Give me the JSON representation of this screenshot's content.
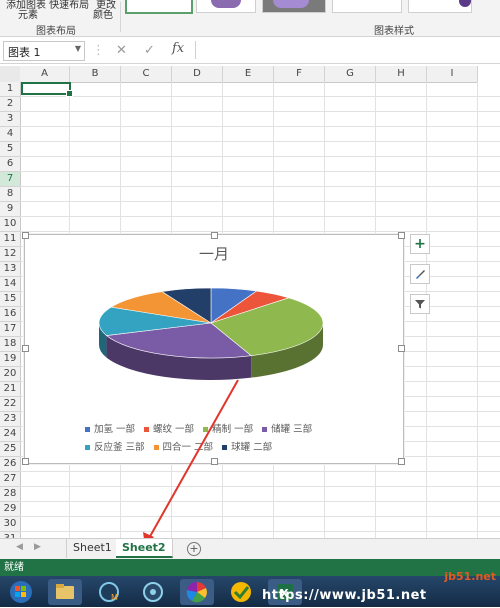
{
  "ribbon": {
    "btn_add_element_top": "添加图表 快速布局",
    "btn_add_element_bottom": "元素",
    "btn_change_color_top": "更改",
    "btn_change_color_bottom": "颜色",
    "group_layout": "图表布局",
    "group_styles": "图表样式"
  },
  "formula_bar": {
    "name_box": "图表 1",
    "cancel_icon": "✕",
    "enter_icon": "✓",
    "fx_label": "fx",
    "value": ""
  },
  "grid": {
    "columns": [
      "A",
      "B",
      "C",
      "D",
      "E",
      "F",
      "G",
      "H",
      "I"
    ],
    "rows": [
      "1",
      "2",
      "3",
      "4",
      "5",
      "6",
      "7",
      "8",
      "9",
      "10",
      "11",
      "12",
      "13",
      "14",
      "15",
      "16",
      "17",
      "18",
      "19",
      "20",
      "21",
      "22",
      "23",
      "24",
      "25",
      "26",
      "27",
      "28",
      "29",
      "30",
      "31"
    ],
    "selected_row": "7"
  },
  "chart_data": {
    "type": "pie",
    "title": "一月",
    "style": "3d",
    "categories": [
      "加氢 一部",
      "螺纹 一部",
      "精制 一部",
      "储罐 三部",
      "反应釜 三部",
      "四合一 二部",
      "球罐 二部"
    ],
    "colors": [
      "#4472c4",
      "#ed553b",
      "#8fb84f",
      "#7a5ba6",
      "#34a3c1",
      "#f39535",
      "#213f69"
    ]
  },
  "chart_tools": {
    "add_icon": "+",
    "brush_icon": "brush-icon",
    "filter_icon": "filter-icon"
  },
  "sheets": {
    "tabs": [
      "Sheet1",
      "Sheet2"
    ],
    "active": "Sheet2",
    "add": "+"
  },
  "status": {
    "text": "就绪"
  },
  "watermark": {
    "site": "jb51.net",
    "url_text": "https://www.jb51.net"
  }
}
